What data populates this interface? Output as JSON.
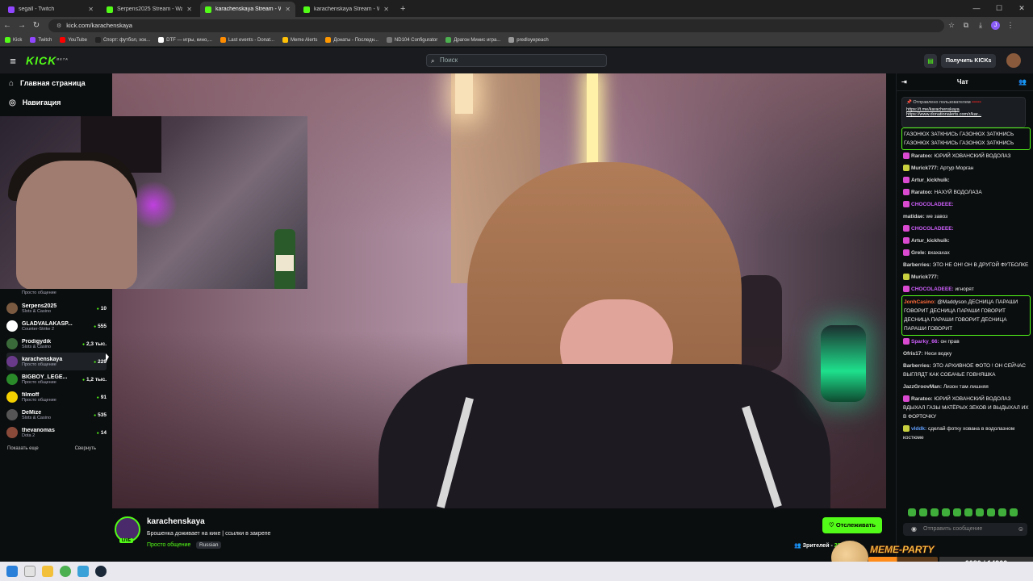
{
  "browser": {
    "tabs": [
      {
        "label": "segall - Twitch",
        "color": "#9146ff",
        "active": false
      },
      {
        "label": "Serpens2025 Stream - Watch L",
        "color": "#53fc18",
        "active": false
      },
      {
        "label": "karachenskaya Stream - Watch",
        "color": "#53fc18",
        "active": true
      },
      {
        "label": "karachenskaya Stream - Watch",
        "color": "#53fc18",
        "active": false
      }
    ],
    "new_tab": "+",
    "url": "kick.com/karachenskaya",
    "profile_initial": "J",
    "bookmarks": [
      {
        "label": "Kick",
        "color": "#53fc18"
      },
      {
        "label": "Twitch",
        "color": "#9146ff"
      },
      {
        "label": "YouTube",
        "color": "#ff0000"
      },
      {
        "label": "Спорт: футбол, хок...",
        "color": "#222"
      },
      {
        "label": "DTF — игры, кино,...",
        "color": "#ffffff"
      },
      {
        "label": "Last events - Donat...",
        "color": "#ff8c00"
      },
      {
        "label": "Meme Alerts",
        "color": "#ffc107"
      },
      {
        "label": "Донаты - Последн...",
        "color": "#ff9800"
      },
      {
        "label": "ND104 Configurator",
        "color": "#777"
      },
      {
        "label": "Драгон Минис игра...",
        "color": "#4caf50"
      },
      {
        "label": "predloyepeach",
        "color": "#999"
      }
    ]
  },
  "header": {
    "logo": "KICK",
    "logo_badge": "BETA",
    "search_placeholder": "Поиск",
    "get_kicks": "Получить KICKs"
  },
  "sidebar": {
    "home": "Главная страница",
    "navigation": "Навигация",
    "prev_category": "Просто общение",
    "streams": [
      {
        "name": "Serpens2025",
        "category": "Slots & Casino",
        "viewers": "10",
        "color": "#7a5a40"
      },
      {
        "name": "GLADVALAKASP...",
        "category": "Counter-Strike 2",
        "viewers": "555",
        "color": "#ffffff"
      },
      {
        "name": "Prodigydik",
        "category": "Slots & Casino",
        "viewers": "2,3 тыс.",
        "color": "#3a6a3a"
      },
      {
        "name": "karachenskaya",
        "category": "Просто общение",
        "viewers": "229",
        "color": "#6a3a8a"
      },
      {
        "name": "BIGBOY_LEGE...",
        "category": "Просто общение",
        "viewers": "1,2 тыс.",
        "color": "#2a8a2a"
      },
      {
        "name": "filmoff",
        "category": "Просто общение",
        "viewers": "91",
        "color": "#f4d000"
      },
      {
        "name": "DeMize",
        "category": "Slots & Casino",
        "viewers": "535",
        "color": "#555"
      },
      {
        "name": "thevanomas",
        "category": "Dota 2",
        "viewers": "14",
        "color": "#8a4a3a"
      }
    ],
    "show_more": "Показать еще",
    "collapse": "Свернуть"
  },
  "chat": {
    "title": "Чат",
    "pinned_by": "Отправлено пользователем",
    "pinned_user": "••••••",
    "pinned_links": [
      "https://t.me/karachenskaya",
      "https://www.donationalerts.com/r/kar..."
    ],
    "messages": [
      {
        "user": "",
        "color": "#fff",
        "text": "ГАЗОНЮХ ЗАТКНИСЬ  ГАЗОНЮХ ЗАТКНИСЬ  ГАЗОНЮХ ЗАТКНИСЬ  ГАЗОНЮХ ЗАТКНИСЬ",
        "badge": "",
        "highlight": true
      },
      {
        "user": "Raratoo:",
        "color": "#d8d8d8",
        "text": "ЮРИЙ ХОВАНСКИЙ ВОДОЛАЗ",
        "badge": "#d94ad0",
        "highlight": false
      },
      {
        "user": "Murick777:",
        "color": "#d8d8d8",
        "text": "Артур Морган",
        "badge": "#c8d040",
        "highlight": false
      },
      {
        "user": "Artur_kickhuik:",
        "color": "#d8d8d8",
        "text": "",
        "badge": "#d94ad0",
        "highlight": false
      },
      {
        "user": "Raratoo:",
        "color": "#d8d8d8",
        "text": "НАХУЙ ВОДОЛАЗА",
        "badge": "#d94ad0",
        "highlight": false
      },
      {
        "user": "CHOCOLADEEE:",
        "color": "#d060ff",
        "text": "",
        "badge": "#d94ad0",
        "highlight": false
      },
      {
        "user": "matidae:",
        "color": "#d8d8d8",
        "text": "we завоз",
        "badge": "",
        "highlight": false
      },
      {
        "user": "CHOCOLADEEE:",
        "color": "#d060ff",
        "text": "",
        "badge": "#d94ad0",
        "highlight": false
      },
      {
        "user": "Artur_kickhuik:",
        "color": "#d8d8d8",
        "text": "",
        "badge": "#d94ad0",
        "highlight": false
      },
      {
        "user": "Grele:",
        "color": "#d8d8d8",
        "text": "вхахахах",
        "badge": "#d94ad0",
        "highlight": false
      },
      {
        "user": "Barberries:",
        "color": "#d8d8d8",
        "text": "ЭТО НЕ ОН! ОН В ДРУГОЙ ФУТБОЛКЕ",
        "badge": "",
        "highlight": false
      },
      {
        "user": "Murick777:",
        "color": "#d8d8d8",
        "text": "",
        "badge": "#c8d040",
        "highlight": false
      },
      {
        "user": "CHOCOLADEEE:",
        "color": "#d060ff",
        "text": "игнорят",
        "badge": "#d94ad0",
        "highlight": false
      },
      {
        "user": "JonhCasino:",
        "color": "#ff6a3a",
        "text": "@Maddyson  ДЕСНИЦА ПАРАШИ ГОВОРИТ  ДЕСНИЦА ПАРАШИ ГОВОРИТ  ДЕСНИЦА ПАРАШИ ГОВОРИТ  ДЕСНИЦА ПАРАШИ ГОВОРИТ",
        "badge": "",
        "highlight": true
      },
      {
        "user": "Sparky_66:",
        "color": "#d060ff",
        "text": "он прав",
        "badge": "#d94ad0",
        "highlight": false
      },
      {
        "user": "Ofris17:",
        "color": "#d8d8d8",
        "text": "Неси водку",
        "badge": "",
        "highlight": false
      },
      {
        "user": "Barberries:",
        "color": "#d8d8d8",
        "text": "ЭТО АРХИВНОЕ ФОТО ! ОН СЕЙЧАС ВЫГЛЯДТ КАК СОБАЧЬЕ ГОВНЯШКА",
        "badge": "",
        "highlight": false
      },
      {
        "user": "JazzGroovMan:",
        "color": "#d8d8d8",
        "text": "Лизон там лишняя",
        "badge": "",
        "highlight": false
      },
      {
        "user": "Raratoo:",
        "color": "#d8d8d8",
        "text": "ЮРИЙ ХОВАНСКИЙ ВОДОЛАЗ ВДЫХАЛ ГАЗЫ МАТЁРЫХ ЗЕКОВ И ВЫДЫХАЛ ИХ В ФОРТОЧКУ",
        "badge": "#d94ad0",
        "highlight": false
      },
      {
        "user": "vlddk:",
        "color": "#60a0ff",
        "text": "сделай фотку хована в водолазном костюме",
        "badge": "#c8d040",
        "highlight": false
      }
    ],
    "input_placeholder": "Отправить сообщение"
  },
  "stream": {
    "channel": "karachenskaya",
    "live_badge": "LIVE",
    "title": "Брошенка доживает на кике | ссылки в закрепе",
    "category": "Просто общение",
    "tag": "Russian",
    "follow": "Отслеживать",
    "viewers_label": "Зрителей -",
    "viewers_value": "229"
  },
  "overlay": {
    "title": "MEME-PARTY",
    "score": "6080 / 14900",
    "progress": 0.41
  }
}
